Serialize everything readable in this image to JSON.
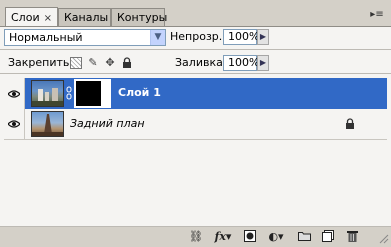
{
  "tabs": [
    {
      "label": "Слои",
      "active": true,
      "close": "×"
    },
    {
      "label": "Каналы",
      "active": false
    },
    {
      "label": "Контуры",
      "active": false
    }
  ],
  "panel_menu_icon": "▸≡",
  "blend_mode": "Нормальный",
  "opacity": {
    "label": "Непрозр.:",
    "value": "100%"
  },
  "lock": {
    "label": "Закрепить:"
  },
  "fill": {
    "label": "Заливка:",
    "value": "100%"
  },
  "layers": [
    {
      "name": "Слой 1",
      "selected": true,
      "has_mask": true
    },
    {
      "name": "Задний план",
      "selected": false,
      "locked": true
    }
  ],
  "colors": {
    "selection": "#3169c6",
    "panel": "#f5f4f2",
    "chrome": "#d4d0c8"
  },
  "toolbar_icons": [
    "link-icon",
    "fx-icon",
    "mask-icon",
    "adjustment-icon",
    "group-icon",
    "new-layer-icon",
    "trash-icon"
  ]
}
